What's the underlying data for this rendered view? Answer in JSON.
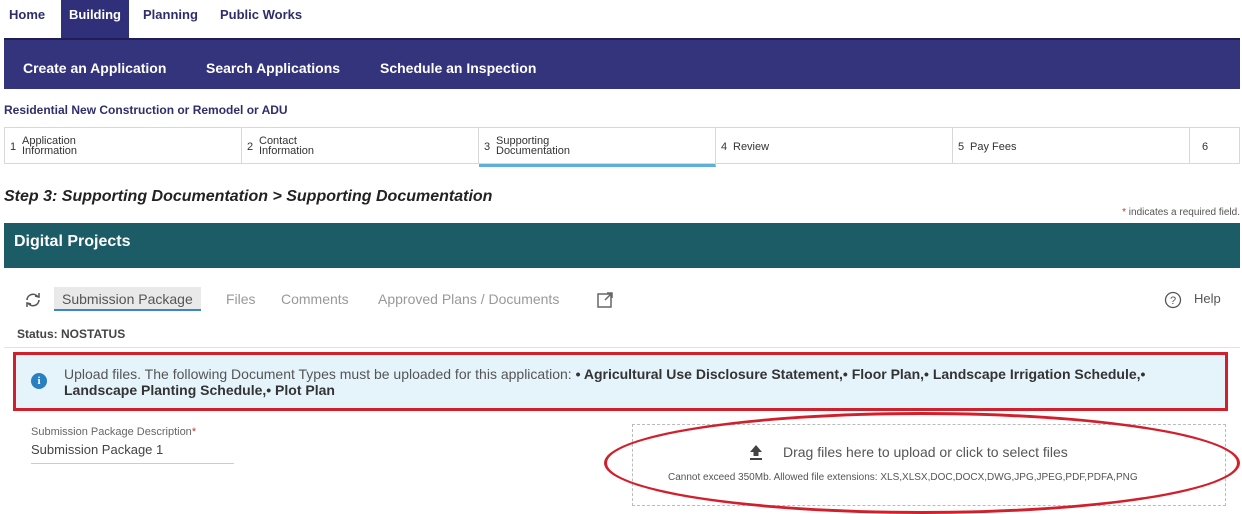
{
  "top_nav": {
    "items": [
      {
        "label": "Home"
      },
      {
        "label": "Building",
        "active": true
      },
      {
        "label": "Planning"
      },
      {
        "label": "Public Works"
      }
    ]
  },
  "sub_nav": {
    "items": [
      {
        "label": "Create an Application"
      },
      {
        "label": "Search Applications"
      },
      {
        "label": "Schedule an Inspection"
      }
    ]
  },
  "application_title": "Residential New Construction or Remodel or ADU",
  "stepper": {
    "steps": [
      {
        "number": "1",
        "line1": "Application",
        "line2": "Information"
      },
      {
        "number": "2",
        "line1": "Contact",
        "line2": "Information"
      },
      {
        "number": "3",
        "line1": "Supporting",
        "line2": "Documentation",
        "active": true
      },
      {
        "number": "4",
        "line1": "Review",
        "line2": ""
      },
      {
        "number": "5",
        "line1": "Pay Fees",
        "line2": ""
      },
      {
        "number": "6",
        "line1": "",
        "line2": ""
      }
    ]
  },
  "step_heading": "Step 3: Supporting Documentation > Supporting Documentation",
  "required_note": {
    "star": "*",
    "text": " indicates a required field."
  },
  "digital_projects": {
    "title": "Digital Projects",
    "tabs": [
      {
        "label": "Submission Package",
        "active": true
      },
      {
        "label": "Files"
      },
      {
        "label": "Comments"
      },
      {
        "label": "Approved Plans / Documents"
      }
    ],
    "help_label": "Help",
    "status_text": "Status: NOSTATUS",
    "info": {
      "intro": "Upload files. The following Document Types must be uploaded for this application: ",
      "documents": "• Agricultural Use Disclosure Statement,• Floor Plan,• Landscape Irrigation Schedule,• Landscape Planting Schedule,• Plot Plan"
    },
    "description_label": "Submission Package Description",
    "description_required": "*",
    "description_value": "Submission Package 1",
    "dropzone": {
      "main": "Drag files here to upload or click to select files",
      "sub": "Cannot exceed 350Mb. Allowed file extensions: XLS,XLSX,DOC,DOCX,DWG,JPG,JPEG,PDF,PDFA,PNG"
    }
  },
  "icons": {
    "refresh": "refresh-icon",
    "external_link": "external-link-icon",
    "help": "help-circle-icon",
    "info": "info-icon",
    "upload": "upload-icon"
  },
  "colors": {
    "nav_dark": "#34347d",
    "header_teal": "#1b5c66",
    "annotation_red": "#d21f2c",
    "info_bg": "#e5f4fb"
  }
}
